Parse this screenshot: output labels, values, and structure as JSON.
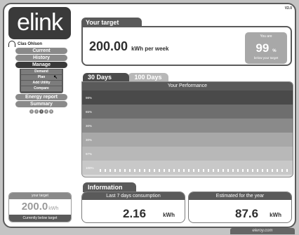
{
  "app": {
    "version": "V2.0",
    "logo": "elink",
    "brand": "eleroy.com"
  },
  "user": {
    "name": "Clas Ohlson"
  },
  "nav": {
    "items": [
      {
        "label": "Current",
        "active": false
      },
      {
        "label": "History",
        "active": false
      },
      {
        "label": "Manage",
        "active": true
      },
      {
        "label": "Energy report",
        "active": false
      },
      {
        "label": "Summary",
        "active": false
      }
    ],
    "manage_sub": [
      "Demand",
      "Plan",
      "Add Utility",
      "Compare"
    ],
    "pager": [
      "1",
      "2",
      "3",
      "4",
      "5"
    ]
  },
  "sidebar_target": {
    "header": "your target",
    "value": "200.0",
    "unit": "kWh",
    "footer": "Currently below target"
  },
  "target": {
    "tab": "Your target",
    "value": "200.00",
    "unit": "kWh per week",
    "you_are_label": "You are",
    "percent": "99",
    "percent_sign": "%",
    "below_label": "below your target"
  },
  "performance": {
    "tabs": [
      "30 Days",
      "100 Days"
    ],
    "header": "Your Performance",
    "bands": [
      {
        "label": "98%",
        "color": "#4a4a4a"
      },
      {
        "label": "65%",
        "color": "#6e6e6e"
      },
      {
        "label": "30%",
        "color": "#8a8a8a"
      },
      {
        "label": "30%",
        "color": "#a8a8a8"
      },
      {
        "label": "97%",
        "color": "#b8b8b8"
      },
      {
        "label": "100%",
        "color": "#c8c8c8"
      }
    ]
  },
  "information": {
    "tab": "Information",
    "last7": {
      "label": "Last 7 days consumption",
      "value": "2.16",
      "unit": "kWh"
    },
    "year": {
      "label": "Estimated for the year",
      "value": "87.6",
      "unit": "kWh"
    }
  }
}
